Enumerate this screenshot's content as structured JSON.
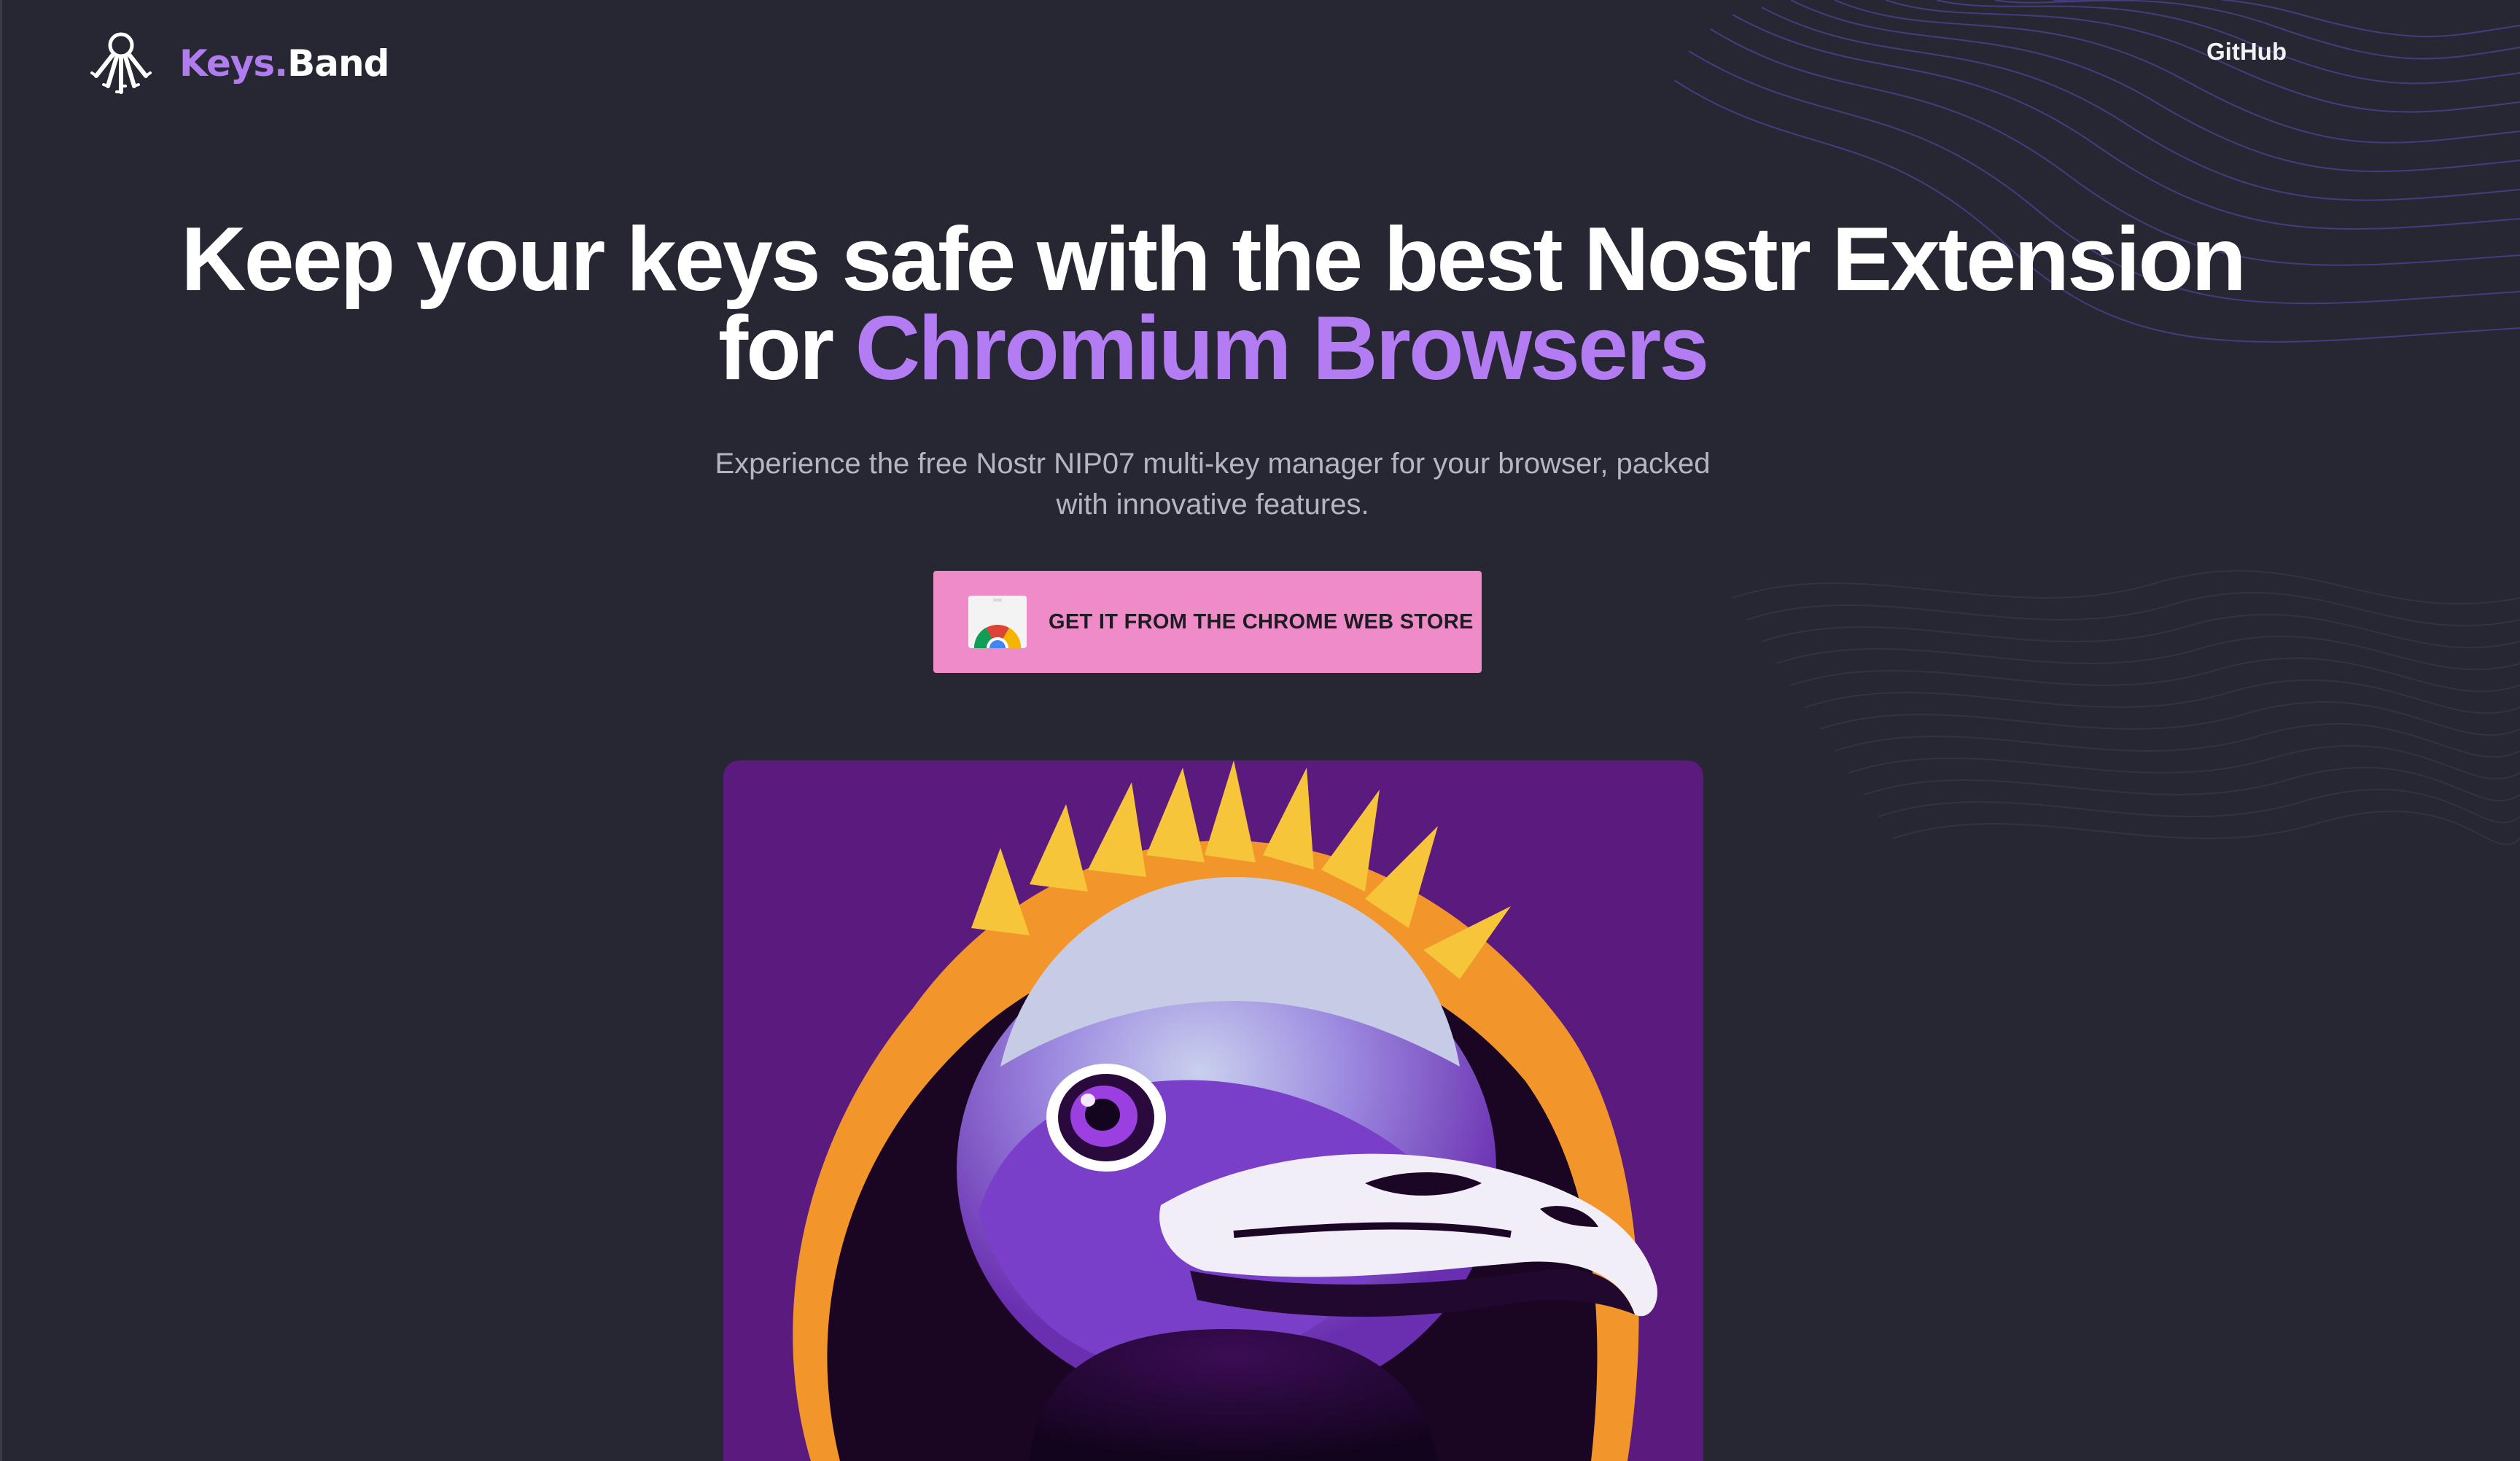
{
  "header": {
    "logo_icon": "keys-ring-icon",
    "brand_first": "Keys.",
    "brand_second": "Band",
    "nav_github": "GitHub"
  },
  "hero": {
    "headline_line1": "Keep your keys safe with the best Nostr Extension",
    "headline_line2_prefix": "for ",
    "headline_line2_highlight": "Chromium Browsers",
    "subtitle_line1": "Experience the free Nostr NIP07 multi-key manager for your browser, packed",
    "subtitle_line2": "with innovative features.",
    "cta_label": "GET IT FROM THE CHROME WEB STORE",
    "cta_icon": "chrome-web-store-icon",
    "image": "ostrich-illustration"
  },
  "colors": {
    "background": "#262732",
    "accent_purple": "#b37cf2",
    "cta_pink": "#ef8bc7",
    "text_white": "#ffffff",
    "text_muted": "#b5b6c0"
  }
}
